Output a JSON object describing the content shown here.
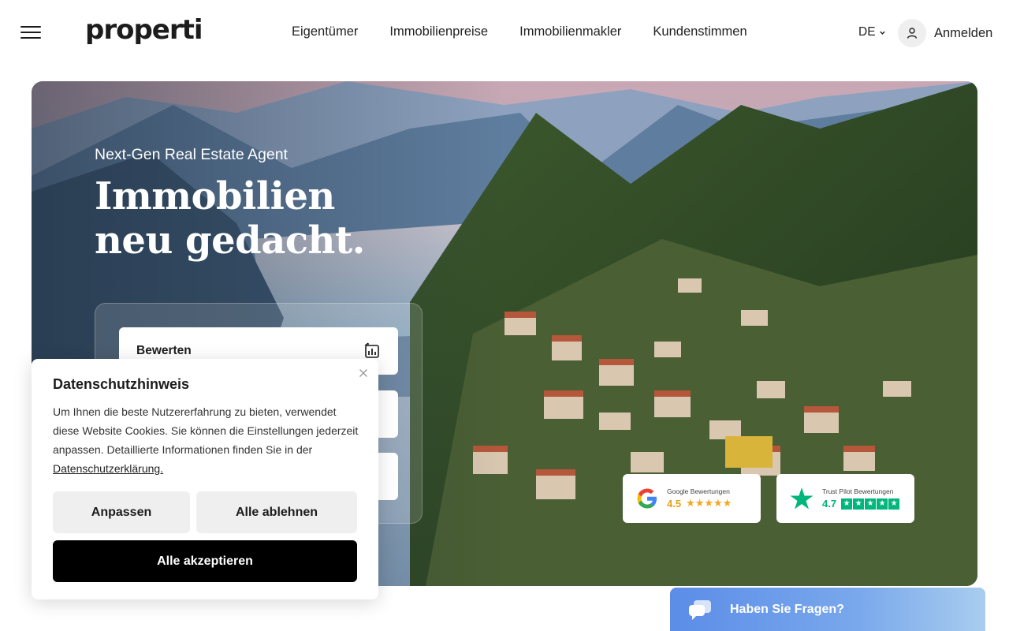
{
  "header": {
    "logo": "properti",
    "nav": [
      {
        "label": "Eigentümer"
      },
      {
        "label": "Immobilienpreise"
      },
      {
        "label": "Immobilienmakler"
      },
      {
        "label": "Kundenstimmen"
      }
    ],
    "language": "DE",
    "login_label": "Anmelden",
    "icons": {
      "menu": "hamburger-menu-icon",
      "language": "chevron-down-icon",
      "login": "user-icon"
    }
  },
  "hero": {
    "kicker": "Next-Gen Real Estate Agent",
    "headline_line1": "Immobilien",
    "headline_line2": "neu gedacht.",
    "actions": [
      {
        "label": "Bewerten",
        "icon": "valuation-chart-icon"
      }
    ],
    "ratings": {
      "google": {
        "source": "Google Bewertungen",
        "score": "4.5",
        "stars": 5,
        "icon": "google-logo-icon"
      },
      "trustpilot": {
        "source": "Trust Pilot Bewertungen",
        "score": "4.7",
        "stars": 5,
        "icon": "trustpilot-star-icon"
      }
    }
  },
  "cookie": {
    "title": "Datenschutzhinweis",
    "body": "Um Ihnen die beste Nutzererfahrung zu bieten, verwendet diese Website Cookies. Sie können die Einstellungen jederzeit anpassen. Detaillierte Informationen finden Sie in der ",
    "link": "Datenschutzerklärung.",
    "adjust_label": "Anpassen",
    "reject_label": "Alle ablehnen",
    "accept_label": "Alle akzeptieren"
  },
  "chat": {
    "label": "Haben Sie Fragen?",
    "icon": "chat-bubbles-icon"
  },
  "colors": {
    "text": "#1c1c1c",
    "accept_button": "#000000",
    "secondary_button": "#efefef",
    "google_star": "#f2a81d",
    "trustpilot_green": "#00b67a",
    "chat_gradient_start": "#5b8de8"
  }
}
